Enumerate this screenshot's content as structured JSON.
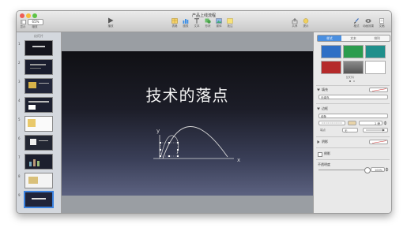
{
  "window": {
    "title": "产品上线流程"
  },
  "toolbar": {
    "zoom_value": "65%",
    "view_label": "显示",
    "zoom_label": "缩放",
    "play_label": "播放",
    "table_label": "表格",
    "chart_label": "图表",
    "text_label": "文本",
    "shape_label": "形状",
    "media_label": "媒体",
    "comment_label": "批注",
    "share_label": "共享",
    "tips_label": "提示",
    "format_label": "格式",
    "animate_label": "动画效果",
    "document_label": "文稿"
  },
  "sidebar": {
    "header": "幻灯片",
    "thumbnails": [
      "1",
      "2",
      "3",
      "4",
      "5",
      "6",
      "7",
      "8",
      "9"
    ]
  },
  "slide": {
    "title": "技术的落点",
    "axis_y_label": "y",
    "axis_x_label": "x"
  },
  "inspector": {
    "tabs": [
      "样式",
      "文本",
      "排列"
    ],
    "preset_label": "幻灯片",
    "fill_label": "填充",
    "fill_type": "无填充",
    "border_label": "边框",
    "border_type": "线条",
    "border_width": "2 磅",
    "end_label": "端点",
    "end_value": "无",
    "shadow_label": "阴影",
    "reflection_label": "倒影",
    "opacity_label": "不透明度",
    "opacity_value": "100%"
  },
  "colors": {
    "swatches": [
      "#2e6fc5",
      "#2b9c4e",
      "#1f8f8b",
      "#b52a2a",
      "#6e6e6e",
      "#ffffff"
    ],
    "accent": "#4a8fe0",
    "curve": "#d8d8d8"
  }
}
